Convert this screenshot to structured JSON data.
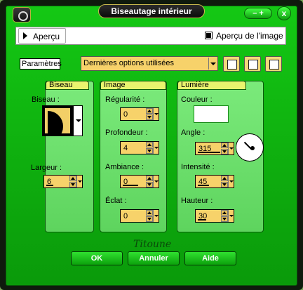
{
  "window": {
    "title": "Biseautage intérieur",
    "min_label": "– +",
    "close_label": "x"
  },
  "preview": {
    "tab_label": "Aperçu",
    "image_preview_label": "Aperçu de l'image",
    "image_preview_checked": true
  },
  "params": {
    "label": "Paramètres",
    "selected": "Dernières options utilisées"
  },
  "groups": {
    "biseau": {
      "title": "Biseau",
      "bevel_label": "Biseau :",
      "width_label": "Largeur :",
      "width_value": "6"
    },
    "image": {
      "title": "Image",
      "regularity_label": "Régularité :",
      "regularity_value": "0",
      "depth_label": "Profondeur :",
      "depth_value": "4",
      "ambience_label": "Ambiance :",
      "ambience_value": "0",
      "shine_label": "Éclat :",
      "shine_value": "0"
    },
    "lumiere": {
      "title": "Lumière",
      "color_label": "Couleur :",
      "angle_label": "Angle :",
      "angle_value": "315",
      "intensity_label": "Intensité :",
      "intensity_value": "45",
      "height_label": "Hauteur :",
      "height_value": "30"
    }
  },
  "signature": "Titoune",
  "buttons": {
    "ok": "OK",
    "cancel": "Annuler",
    "help": "Aide"
  },
  "colors": {
    "frame_green": "#14c814",
    "spin_yellow": "#f7d26a",
    "panel_header": "#e9f46e"
  }
}
